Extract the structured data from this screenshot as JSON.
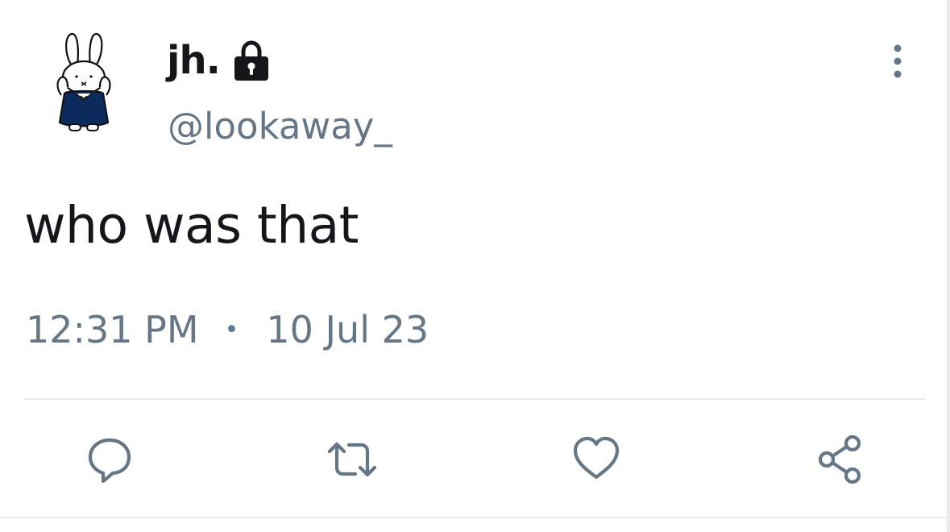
{
  "user": {
    "display_name": "jh.",
    "handle": "@lookaway_",
    "protected": true,
    "avatar": "miffy-avatar"
  },
  "tweet": {
    "text": "who was that",
    "time": "12:31 PM",
    "separator": "•",
    "date": "10 Jul 23"
  },
  "actions": [
    {
      "icon": "reply-icon"
    },
    {
      "icon": "retweet-icon"
    },
    {
      "icon": "like-icon"
    },
    {
      "icon": "share-icon"
    }
  ],
  "colors": {
    "text_primary": "#14171a",
    "text_secondary": "#657786",
    "divider": "#e6ecf0",
    "avatar_dress": "#0d2a5c"
  }
}
